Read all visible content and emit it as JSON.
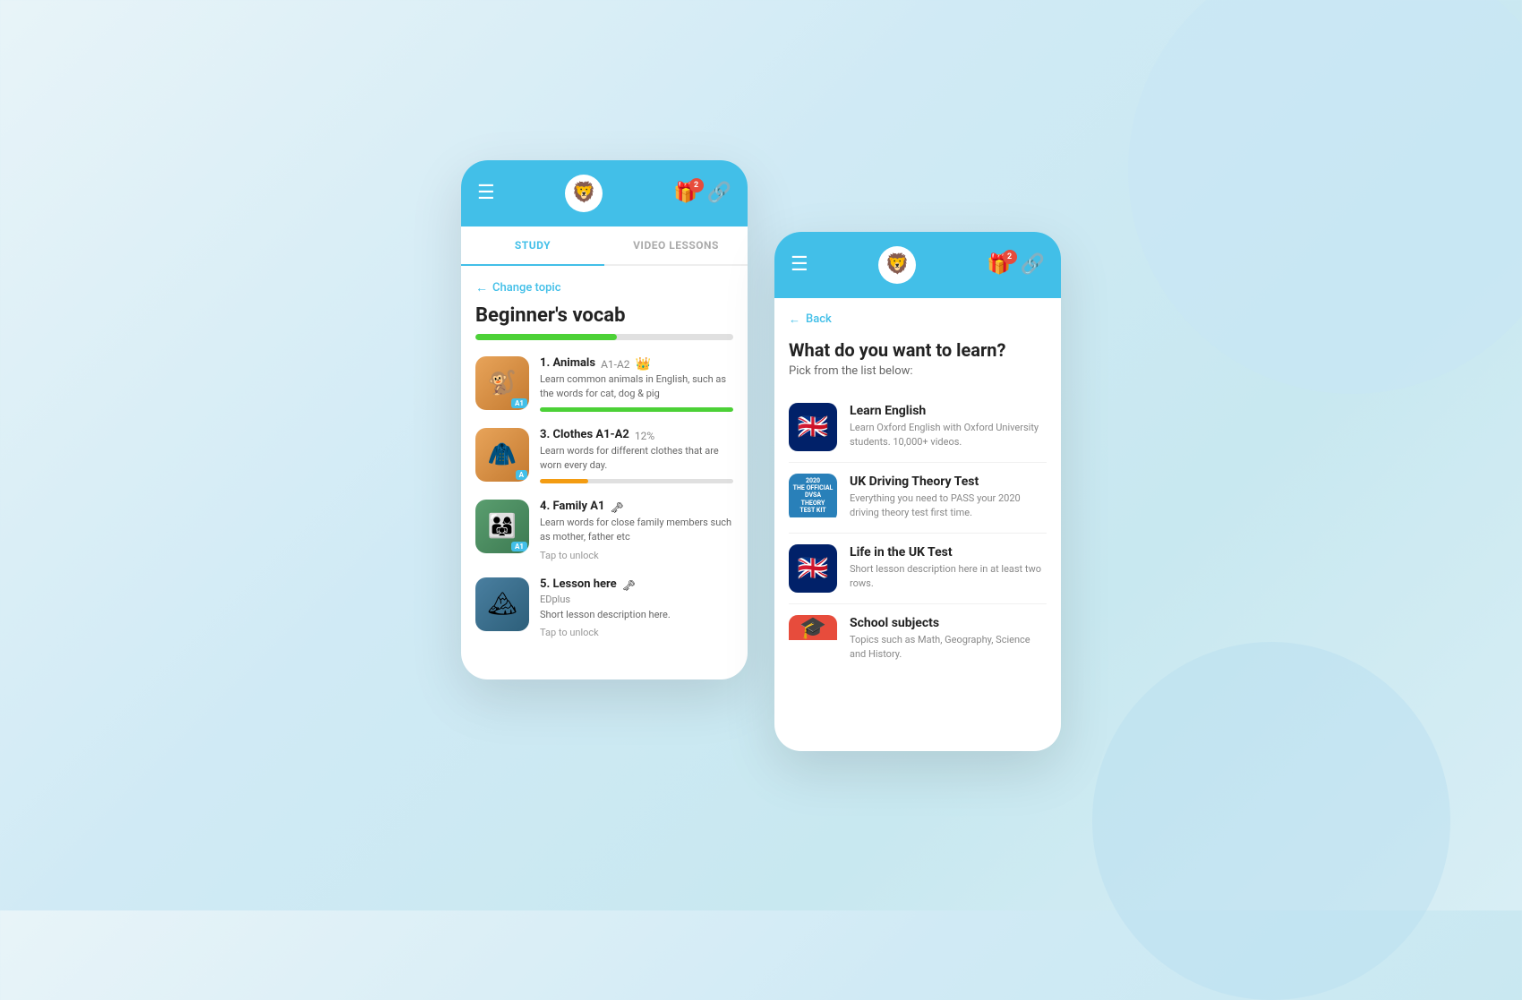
{
  "left_phone": {
    "header": {
      "menu_icon": "☰",
      "avatar_emoji": "🦁",
      "badge_count": "2",
      "link_icon": "🔗"
    },
    "tabs": [
      {
        "label": "STUDY",
        "active": true
      },
      {
        "label": "VIDEO LESSONS",
        "active": false
      }
    ],
    "change_topic_label": "Change topic",
    "topic_title": "Beginner's vocab",
    "progress_percent": 55,
    "lessons": [
      {
        "number": "1.",
        "name": "Animals",
        "level": "A1-A2",
        "trophy": "👑",
        "description": "Learn common animals in English, such as the words for cat, dog & pig",
        "progress": 100,
        "locked": false,
        "thumb_emoji": "🐒",
        "thumb_class": "lesson-thumb-animals"
      },
      {
        "number": "3.",
        "name": "Clothes",
        "level": "A1-A2",
        "percent": "12%",
        "description": "Learn words for different clothes that are worn every day.",
        "progress": 25,
        "locked": false,
        "thumb_emoji": "👗",
        "thumb_class": "lesson-thumb-clothes"
      },
      {
        "number": "4.",
        "name": "Family",
        "level": "A1",
        "key": "🗝",
        "description": "Learn words for close family members such as mother, father etc",
        "tap_unlock": "Tap to unlock",
        "progress": 0,
        "locked": true,
        "thumb_emoji": "👨‍👩‍👧",
        "thumb_class": "lesson-thumb-family"
      },
      {
        "number": "5.",
        "name": "Lesson here",
        "key": "🗝",
        "edplus": "EDplus",
        "description": "Short lesson description here.",
        "tap_unlock": "Tap to unlock",
        "locked": true,
        "thumb_emoji": "🏔",
        "thumb_class": "lesson-thumb-lesson"
      }
    ]
  },
  "right_phone": {
    "header": {
      "menu_icon": "☰",
      "avatar_emoji": "🦁",
      "badge_count": "2",
      "link_icon": "🔗"
    },
    "back_label": "Back",
    "title": "What do you want to learn?",
    "subtitle": "Pick from the list below:",
    "topics": [
      {
        "name": "Learn English",
        "description": "Learn Oxford English with Oxford University students. 10,000+ videos.",
        "thumb_type": "uk-flag"
      },
      {
        "name": "UK Driving Theory Test",
        "description": "Everything  you need to PASS your 2020 driving theory test first time.",
        "thumb_type": "driving"
      },
      {
        "name": "Life in the UK Test",
        "description": "Short lesson description here in at least two rows.",
        "thumb_type": "uk-flag"
      },
      {
        "name": "School subjects",
        "description": "Topics such as Math, Geography, Science and History.",
        "thumb_type": "school"
      }
    ]
  }
}
